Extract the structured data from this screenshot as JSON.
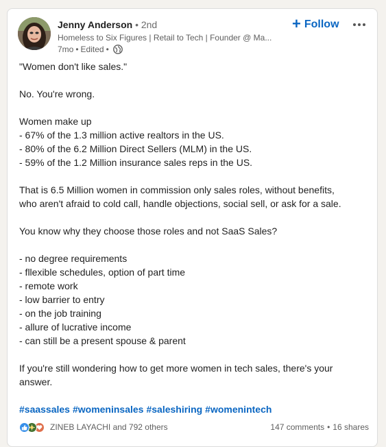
{
  "post": {
    "author": {
      "name": "Jenny Anderson",
      "separator": "•",
      "degree": "2nd",
      "headline": "Homeless to Six Figures | Retail to Tech | Founder @ Ma...",
      "age": "7mo",
      "edited": "Edited",
      "visibility_icon": "globe-icon"
    },
    "follow_label": "Follow",
    "body_lines": [
      "\"Women don't like sales.\"",
      "",
      "No. You're wrong.",
      "",
      "Women make up",
      "- 67% of the 1.3 million active realtors in the US.",
      "- 80% of the 6.2 Million Direct Sellers (MLM) in the US.",
      "- 59% of the 1.2 Million insurance sales reps in the US.",
      "",
      "That is 6.5 Million women in commission only sales roles, without benefits,",
      "who aren't afraid to cold call, handle objections, social sell, or ask for a sale.",
      "",
      "You know why they choose those roles and not SaaS Sales?",
      "",
      "- no degree requirements",
      "- fllexible schedules, option of part time",
      "- remote work",
      "- low barrier to entry",
      "- on the job training",
      "- allure of lucrative income",
      "- can still be a present spouse & parent",
      "",
      "If you're still wondering how to get more women in tech sales, there's your",
      "answer."
    ],
    "hashtags": [
      "#saassales",
      "#womeninsales",
      "#saleshiring",
      "#womenintech"
    ],
    "social": {
      "reaction_icons": [
        "like-icon",
        "celebrate-icon",
        "love-icon"
      ],
      "reactors": "ZINEB LAYACHI and 792 others",
      "comments": "147 comments",
      "dot": "•",
      "shares": "16 shares"
    },
    "colors": {
      "link_blue": "#0a66c2",
      "like_blue": "#378fe9",
      "celebrate_green": "#44712e",
      "love_red": "#df704d"
    }
  }
}
